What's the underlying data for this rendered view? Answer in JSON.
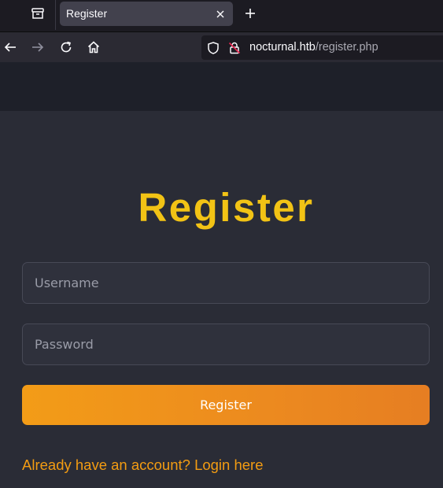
{
  "browser": {
    "tab": {
      "title": "Register"
    },
    "url": {
      "host": "nocturnal.htb",
      "path": "/register.php"
    }
  },
  "page": {
    "heading": "Register",
    "username": {
      "placeholder": "Username",
      "value": ""
    },
    "password": {
      "placeholder": "Password",
      "value": ""
    },
    "submit_label": "Register",
    "login_link": "Already have an account? Login here"
  },
  "colors": {
    "accent_yellow": "#f2c315",
    "accent_orange": "#f39c12",
    "page_background": "#2a2c36",
    "header_background": "#1e2029"
  },
  "icons": {
    "tab_list": "tab-list-icon",
    "tab_close": "close-icon",
    "new_tab": "plus-icon",
    "back": "arrow-left-icon",
    "forward": "arrow-right-icon",
    "reload": "reload-icon",
    "home": "home-icon",
    "tracking_protection": "shield-icon",
    "insecure_connection": "insecure-lock-icon"
  }
}
